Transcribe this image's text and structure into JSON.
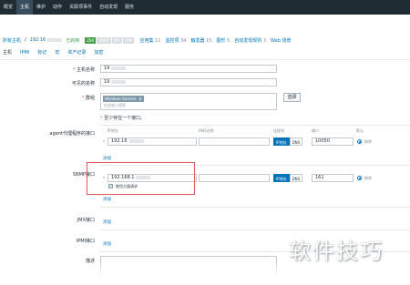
{
  "nav": [
    "概览",
    "主机",
    "维护",
    "动作",
    "关联项事件",
    "自动发现",
    "服务"
  ],
  "nav_active": 1,
  "hostbar": {
    "crumb1": "所有主机",
    "crumb_sep": "/",
    "host": "192.16",
    "status": "已启用",
    "badges": [
      "ZBX",
      "SNMP",
      "JMX",
      "IPMI"
    ],
    "links": [
      {
        "label": "应用集",
        "count": "11"
      },
      {
        "label": "监控项",
        "count": "34"
      },
      {
        "label": "触发器",
        "count": "15"
      },
      {
        "label": "图形",
        "count": "5"
      },
      {
        "label": "自动发现规则",
        "count": "3"
      },
      {
        "label": "Web 场景",
        "count": ""
      }
    ]
  },
  "tabs": [
    "主机",
    "IPMI",
    "标记",
    "宏",
    "资产记录",
    "加密"
  ],
  "tabs_active": 0,
  "form": {
    "hostname_label": "主机名称",
    "hostname_value": "19",
    "visible_label": "可见的名称",
    "visible_value": "19",
    "group_label": "群组",
    "group_tag": "Windows Servers",
    "group_tag_x": "×",
    "group_placeholder": "在此输入搜索",
    "select_button": "选择",
    "note": "至少存在一个接口。",
    "req_mark": "*"
  },
  "interfaces": {
    "columns": [
      "IP地址",
      "DNS名称",
      "连接到",
      "端口",
      "默认"
    ],
    "agent": {
      "label": "agent代理程序的接口",
      "ip": "192.16",
      "connect_ip": "IP地址",
      "connect_dns": "DNS",
      "port": "10050",
      "remove": "移除",
      "add": "添加"
    },
    "snmp": {
      "label": "SNMP接口",
      "ip": "192.168.1",
      "connect_ip": "IP地址",
      "connect_dns": "DNS",
      "port": "161",
      "remove": "移除",
      "bulk_label": "使用大量请求",
      "bulk_checked": "✔",
      "add": "添加"
    },
    "jmx": {
      "label": "JMX接口",
      "add": "添加"
    },
    "ipmi": {
      "label": "IPMI接口",
      "add": "添加"
    },
    "desc": {
      "label": "描述"
    }
  },
  "watermark": "软件技巧"
}
